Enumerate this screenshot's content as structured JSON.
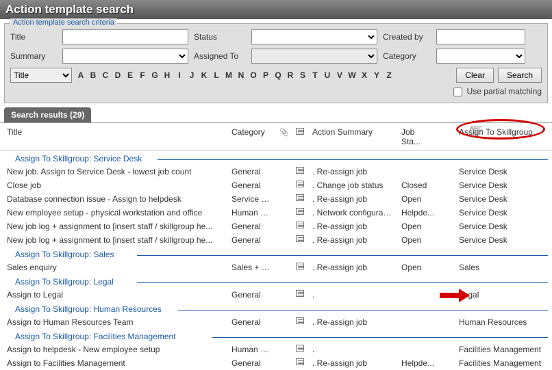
{
  "window": {
    "title": "Action template search"
  },
  "criteria": {
    "legend": "Action template search criteria",
    "fields": {
      "title": {
        "label": "Title",
        "value": ""
      },
      "status": {
        "label": "Status",
        "value": ""
      },
      "created_by": {
        "label": "Created by",
        "value": ""
      },
      "summary": {
        "label": "Summary",
        "value": ""
      },
      "assigned_to": {
        "label": "Assigned To",
        "value": ""
      },
      "category": {
        "label": "Category",
        "value": ""
      }
    },
    "sort_field": "Title",
    "alphabet": [
      "A",
      "B",
      "C",
      "D",
      "E",
      "F",
      "G",
      "H",
      "I",
      "J",
      "K",
      "L",
      "M",
      "N",
      "O",
      "P",
      "Q",
      "R",
      "S",
      "T",
      "U",
      "V",
      "W",
      "X",
      "Y",
      "Z"
    ],
    "buttons": {
      "clear": "Clear",
      "search": "Search"
    },
    "partial_matching_label": "Use partial matching",
    "partial_matching_checked": false
  },
  "results": {
    "tab_label": "Search results (29)",
    "count": 29,
    "columns": {
      "title": "Title",
      "category": "Category",
      "summary": "Action Summary",
      "status": "Job Sta...",
      "skillgroup": "Assign To Skillgroup"
    },
    "sorted_by": "Assign To Skillgroup",
    "groups": [
      {
        "label": "Assign To Skillgroup: Service Desk",
        "rows": [
          {
            "title": "New job.  Assign to Service Desk - lowest job count",
            "category": "General",
            "summary": ". Re-assign job",
            "status": "",
            "skillgroup": "Service Desk"
          },
          {
            "title": "Close job",
            "category": "General",
            "summary": ". Change job status",
            "status": "Closed",
            "skillgroup": "Service Desk"
          },
          {
            "title": "Database connection issue - Assign to helpdesk",
            "category": "Service D...",
            "summary": ". Re-assign job",
            "status": "Open",
            "skillgroup": "Service Desk"
          },
          {
            "title": "New employee setup - physical workstation and office",
            "category": "Human R...",
            "summary": ". Network configuration",
            "status": "Helpde...",
            "skillgroup": "Service Desk"
          },
          {
            "title": "New job log + assignment to [insert staff / skillgroup he...",
            "category": "General",
            "summary": ". Re-assign job",
            "status": "Open",
            "skillgroup": "Service Desk"
          },
          {
            "title": "New job log + assignment to [insert staff / skillgroup he...",
            "category": "General",
            "summary": ". Re-assign job",
            "status": "Open",
            "skillgroup": "Service Desk"
          }
        ]
      },
      {
        "label": "Assign To Skillgroup: Sales",
        "rows": [
          {
            "title": "Sales enquiry",
            "category": "Sales + C...",
            "summary": ". Re-assign job",
            "status": "Open",
            "skillgroup": "Sales"
          }
        ]
      },
      {
        "label": "Assign To Skillgroup: Legal",
        "rows": [
          {
            "title": "Assign to Legal",
            "category": "General",
            "summary": ".",
            "status": "",
            "skillgroup": "Legal"
          }
        ]
      },
      {
        "label": "Assign To Skillgroup: Human Resources",
        "rows": [
          {
            "title": "Assign to Human Resources Team",
            "category": "General",
            "summary": ". Re-assign job",
            "status": "",
            "skillgroup": "Human Resources"
          }
        ]
      },
      {
        "label": "Assign To Skillgroup: Facilities Management",
        "rows": [
          {
            "title": "Assign to helpdesk - New employee setup",
            "category": "Human R...",
            "summary": ".",
            "status": "",
            "skillgroup": "Facilities Management"
          },
          {
            "title": "Assign to Facilities Management",
            "category": "General",
            "summary": ". Re-assign job",
            "status": "Helpde...",
            "skillgroup": "Facilities Management"
          }
        ]
      }
    ]
  },
  "annotations": {
    "ellipse_target": "col-skillgroup",
    "arrow_target": "Legal"
  }
}
